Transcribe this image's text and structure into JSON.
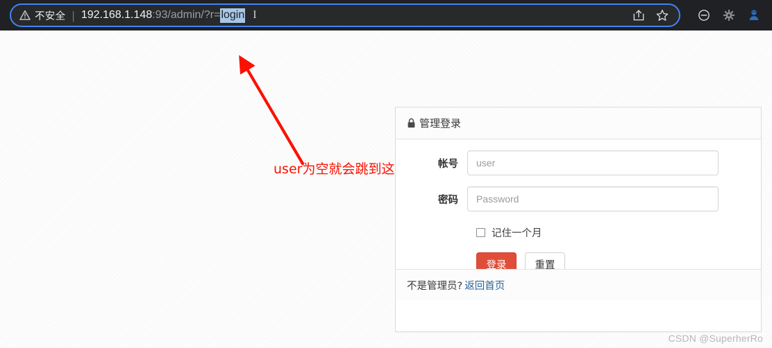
{
  "browser": {
    "security_icon": "warning-triangle-icon",
    "security_label": "不安全",
    "separator": "|",
    "url_host": "192.168.1.148",
    "url_rest": ":93/admin/?r=",
    "url_selected": "login",
    "caret_glyph": "I",
    "omnibox_actions": [
      {
        "name": "share-icon",
        "label": "Share"
      },
      {
        "name": "bookmark-star-icon",
        "label": "Bookmark"
      }
    ],
    "toolbar_icons": [
      {
        "name": "zoom-out-icon",
        "label": "Zoom out"
      },
      {
        "name": "extension-bug-icon",
        "label": "Extension"
      },
      {
        "name": "profile-avatar-icon",
        "label": "Profile"
      }
    ]
  },
  "login_panel": {
    "header": {
      "lock_icon": "lock-icon",
      "title": "管理登录"
    },
    "fields": [
      {
        "label": "帐号",
        "placeholder": "user",
        "value": "",
        "type": "text",
        "name": "username-field"
      },
      {
        "label": "密码",
        "placeholder": "Password",
        "value": "",
        "type": "password",
        "name": "password-field"
      }
    ],
    "remember": {
      "label": "记住一个月",
      "checked": false
    },
    "buttons": {
      "submit": "登录",
      "reset": "重置"
    },
    "footer": {
      "text": "不是管理员?",
      "link": "返回首页"
    }
  },
  "annotation": {
    "text": "user为空就会跳到这个地址",
    "color": "#fb1100"
  },
  "watermark": "CSDN @SuperherRo",
  "colors": {
    "accent_red": "#e04e39",
    "omnibox_focus_blue": "#4285f4",
    "link_blue": "#2a6496",
    "chrome_dark": "#202124"
  }
}
